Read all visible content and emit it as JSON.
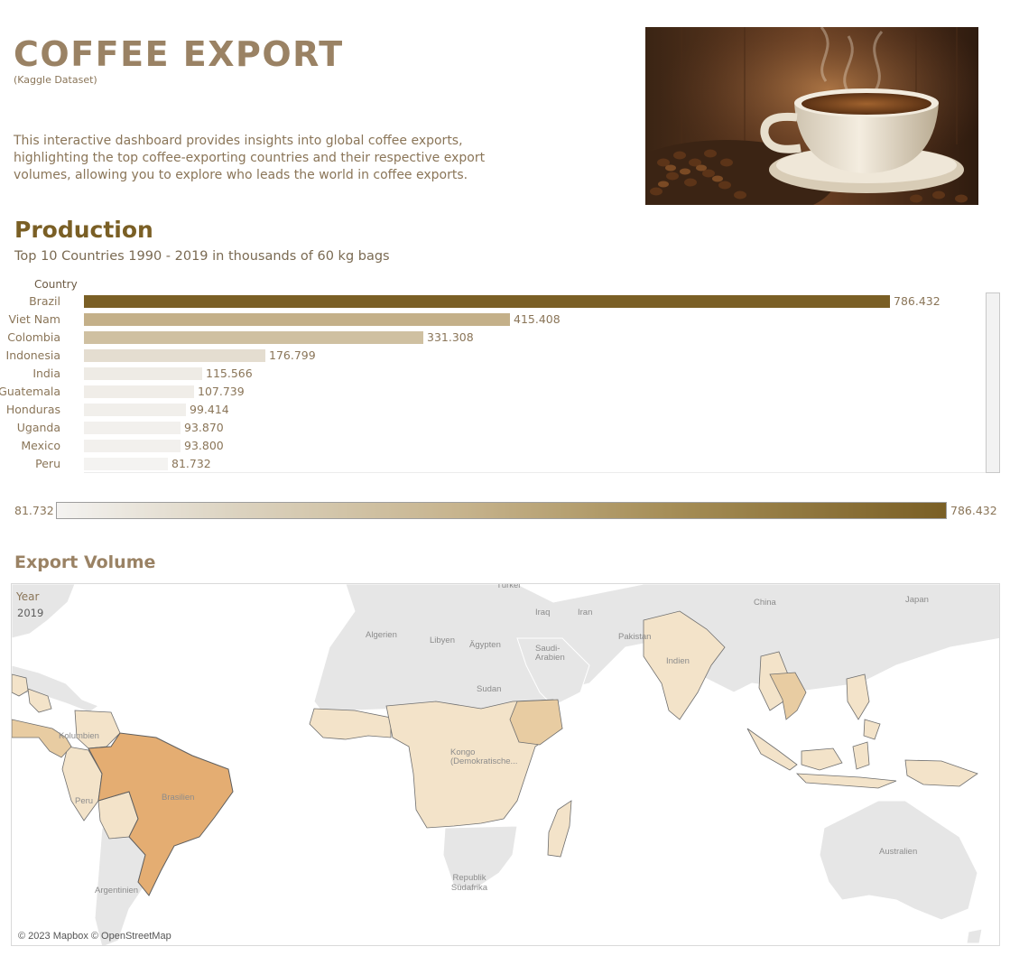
{
  "header": {
    "title": "COFFEE EXPORT",
    "subtitle": "(Kaggle Dataset)",
    "description": "This interactive dashboard provides insights into global coffee exports, highlighting the top coffee-exporting countries and their respective export volumes, allowing you to explore who leads the world in coffee exports.",
    "hero_image": "coffee-cup-photo"
  },
  "production": {
    "title": "Production",
    "subtitle": "Top 10 Countries 1990 - 2019 in thousands of 60 kg bags",
    "column_header": "Country"
  },
  "chart_data": {
    "type": "bar",
    "orientation": "horizontal",
    "categories": [
      "Brazil",
      "Viet Nam",
      "Colombia",
      "Indonesia",
      "India",
      "Guatemala",
      "Honduras",
      "Uganda",
      "Mexico",
      "Peru"
    ],
    "values": [
      786.432,
      415.408,
      331.308,
      176.799,
      115.566,
      107.739,
      99.414,
      93.87,
      93.8,
      81.732
    ],
    "value_labels": [
      "786.432",
      "415.408",
      "331.308",
      "176.799",
      "115.566",
      "107.739",
      "99.414",
      "93.870",
      "93.800",
      "81.732"
    ],
    "title": "Production",
    "subtitle": "Top 10 Countries 1990 - 2019 in thousands of 60 kg bags",
    "ylabel": "Country",
    "xlim": [
      0,
      786.432
    ],
    "color_scale": {
      "min_color": "#f4f3f1",
      "max_color": "#7a5f25",
      "min": 81.732,
      "max": 786.432
    }
  },
  "legend": {
    "min_label": "81.732",
    "max_label": "786.432"
  },
  "export": {
    "title": "Export Volume",
    "year_label": "Year",
    "year_value": "2019",
    "credit": "© 2023 Mapbox © OpenStreetMap",
    "places": [
      "Türkei",
      "Iraq",
      "Iran",
      "China",
      "Japan",
      "Algerien",
      "Libyen",
      "Ägypten",
      "Saudi-Arabien",
      "Pakistan",
      "Indien",
      "Sudan",
      "Kolumbien",
      "Kongo (Demokratische...",
      "Peru",
      "Brasilien",
      "Argentinien",
      "Republik Südafrika",
      "Australien"
    ]
  },
  "colors": {
    "accent_dark": "#7a5f25",
    "accent": "#9a8264",
    "map_land": "#e6e6e6",
    "map_exporter_light": "#f3e3c9",
    "map_exporter_mid": "#e8cca2",
    "map_exporter_max": "#e4ad72"
  }
}
